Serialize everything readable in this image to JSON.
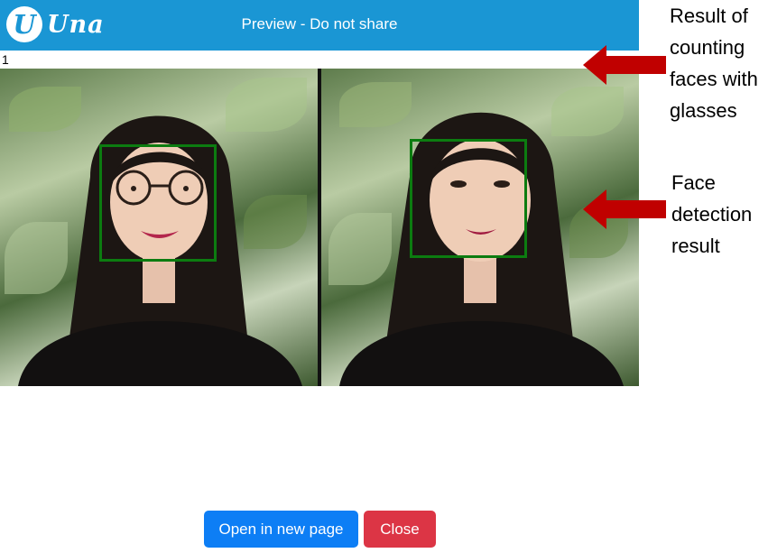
{
  "header": {
    "logo_letter": "U",
    "logo_text": "Una",
    "title": "Preview - Do not share"
  },
  "result_count": "1",
  "photos": [
    {
      "label": "photo-with-glasses",
      "has_glasses": true,
      "face_detected": true
    },
    {
      "label": "photo-without-glasses",
      "has_glasses": false,
      "face_detected": true
    }
  ],
  "annotations": {
    "count_note": [
      "Result of",
      "counting",
      "faces with",
      "glasses"
    ],
    "detection_note": [
      "Face",
      "detection",
      "result"
    ]
  },
  "buttons": {
    "open_label": "Open in new page",
    "close_label": "Close"
  },
  "colors": {
    "header": "#1a96d4",
    "face_box": "#0c7c10",
    "arrow": "#c00000",
    "open_button": "#0d7ef5",
    "close_button": "#dc3545"
  }
}
